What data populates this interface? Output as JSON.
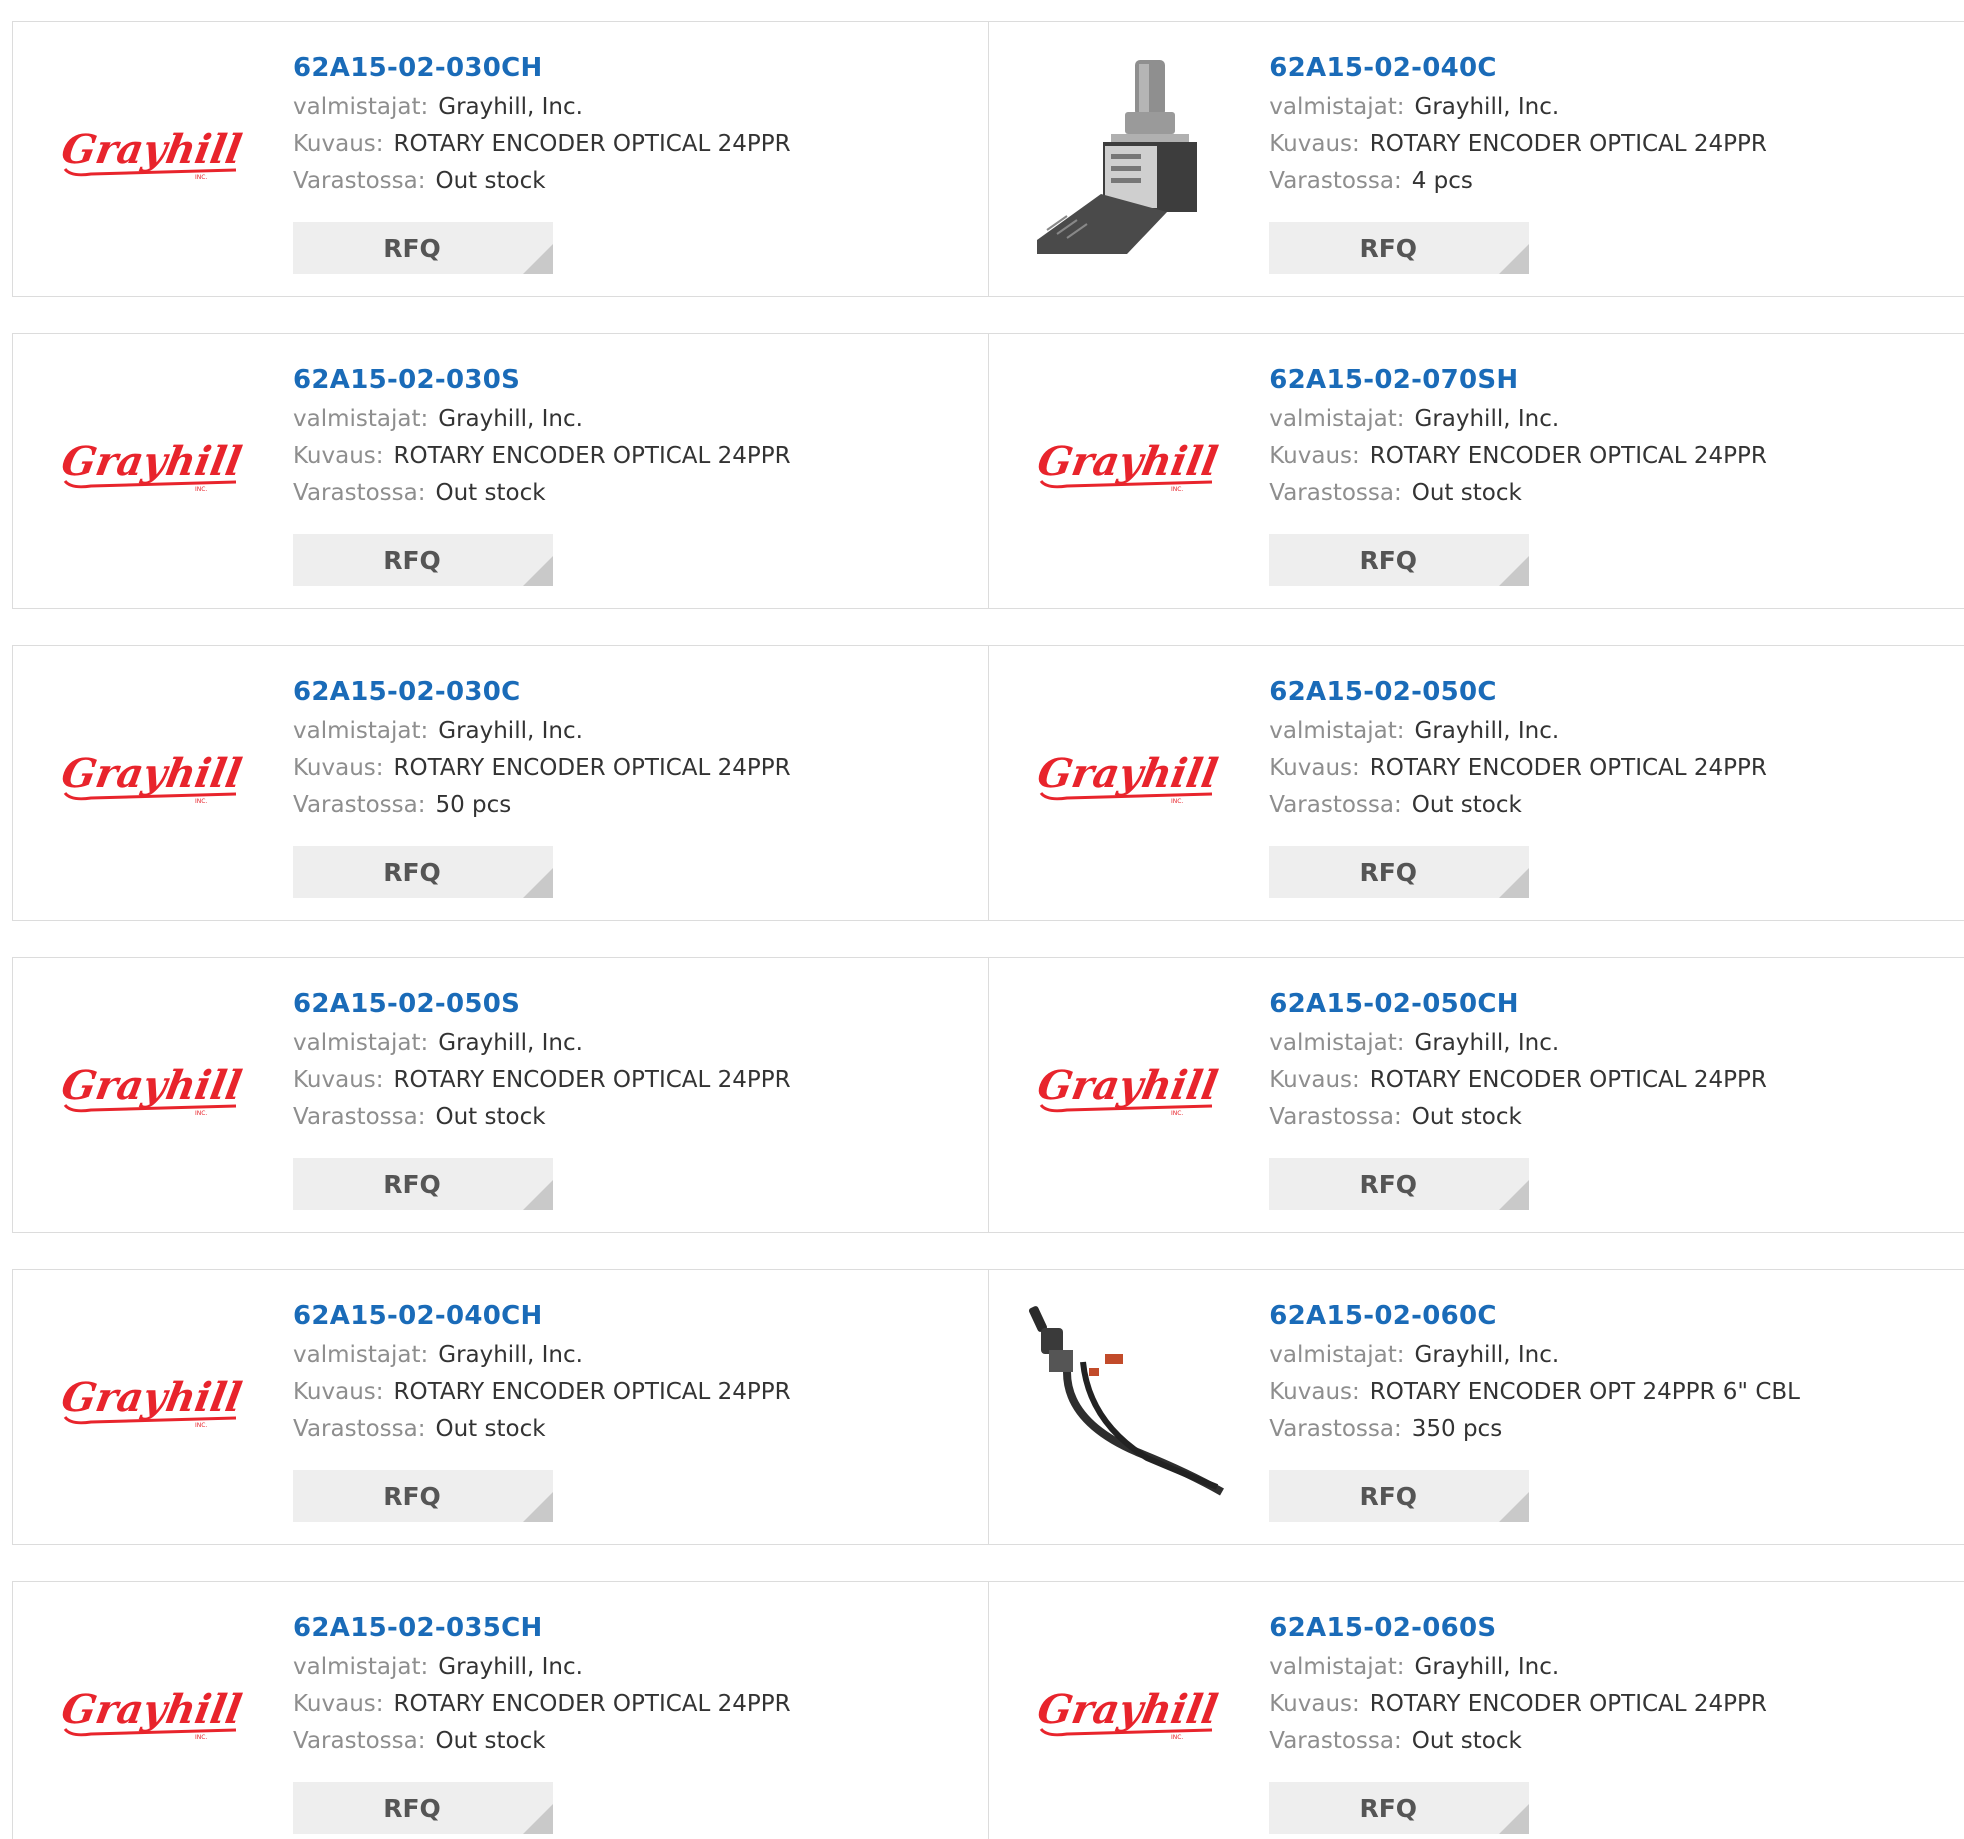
{
  "labels": {
    "manufacturer": "valmistajat:",
    "description": "Kuvaus:",
    "stock": "Varastossa:",
    "rfq": "RFQ"
  },
  "brand": {
    "logo_text": "Grayhill",
    "logo_sub": "INC.",
    "color": "#e8242c"
  },
  "link_color": "#1a6bb8",
  "products": [
    {
      "pn": "62A15-02-030CH",
      "manufacturer": "Grayhill, Inc.",
      "description": "ROTARY ENCODER OPTICAL 24PPR",
      "stock": "Out stock",
      "image": "grayhill-logo"
    },
    {
      "pn": "62A15-02-040C",
      "manufacturer": "Grayhill, Inc.",
      "description": "ROTARY ENCODER OPTICAL 24PPR",
      "stock": "4 pcs",
      "image": "encoder-photo"
    },
    {
      "pn": "62A15-02-030S",
      "manufacturer": "Grayhill, Inc.",
      "description": "ROTARY ENCODER OPTICAL 24PPR",
      "stock": "Out stock",
      "image": "grayhill-logo"
    },
    {
      "pn": "62A15-02-070SH",
      "manufacturer": "Grayhill, Inc.",
      "description": "ROTARY ENCODER OPTICAL 24PPR",
      "stock": "Out stock",
      "image": "grayhill-logo"
    },
    {
      "pn": "62A15-02-030C",
      "manufacturer": "Grayhill, Inc.",
      "description": "ROTARY ENCODER OPTICAL 24PPR",
      "stock": "50 pcs",
      "image": "grayhill-logo"
    },
    {
      "pn": "62A15-02-050C",
      "manufacturer": "Grayhill, Inc.",
      "description": "ROTARY ENCODER OPTICAL 24PPR",
      "stock": "Out stock",
      "image": "grayhill-logo"
    },
    {
      "pn": "62A15-02-050S",
      "manufacturer": "Grayhill, Inc.",
      "description": "ROTARY ENCODER OPTICAL 24PPR",
      "stock": "Out stock",
      "image": "grayhill-logo"
    },
    {
      "pn": "62A15-02-050CH",
      "manufacturer": "Grayhill, Inc.",
      "description": "ROTARY ENCODER OPTICAL 24PPR",
      "stock": "Out stock",
      "image": "grayhill-logo"
    },
    {
      "pn": "62A15-02-040CH",
      "manufacturer": "Grayhill, Inc.",
      "description": "ROTARY ENCODER OPTICAL 24PPR",
      "stock": "Out stock",
      "image": "grayhill-logo"
    },
    {
      "pn": "62A15-02-060C",
      "manufacturer": "Grayhill, Inc.",
      "description": "ROTARY ENCODER OPT 24PPR 6\" CBL",
      "stock": "350 pcs",
      "image": "encoder-cable-photo"
    },
    {
      "pn": "62A15-02-035CH",
      "manufacturer": "Grayhill, Inc.",
      "description": "ROTARY ENCODER OPTICAL 24PPR",
      "stock": "Out stock",
      "image": "grayhill-logo"
    },
    {
      "pn": "62A15-02-060S",
      "manufacturer": "Grayhill, Inc.",
      "description": "ROTARY ENCODER OPTICAL 24PPR",
      "stock": "Out stock",
      "image": "grayhill-logo"
    }
  ]
}
